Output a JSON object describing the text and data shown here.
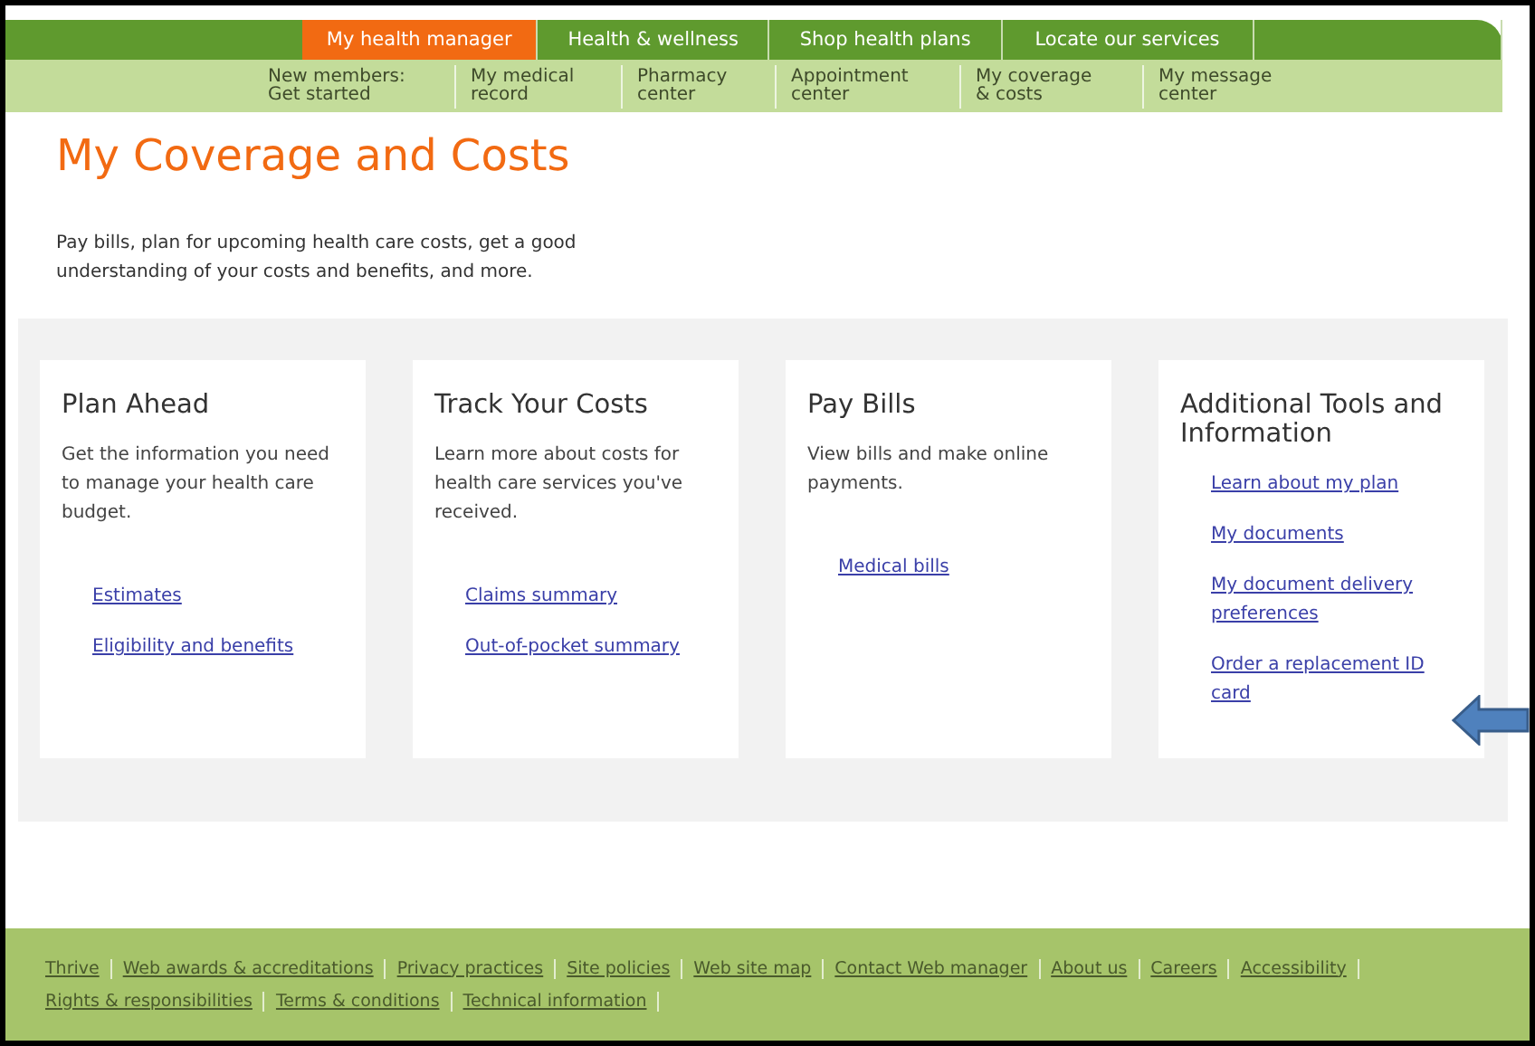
{
  "nav": {
    "tabs": [
      {
        "label": "My health manager",
        "selected": true
      },
      {
        "label": "Health & wellness",
        "selected": false
      },
      {
        "label": "Shop health plans",
        "selected": false
      },
      {
        "label": "Locate our services",
        "selected": false
      }
    ],
    "subnav": [
      "New members:\nGet started",
      "My medical\nrecord",
      "Pharmacy\ncenter",
      "Appointment\ncenter",
      "My coverage\n& costs",
      "My message\ncenter"
    ]
  },
  "page": {
    "title": "My Coverage and Costs",
    "intro": "Pay bills, plan for upcoming health care costs, get a good understanding of your costs and benefits, and more."
  },
  "cards": [
    {
      "title": "Plan Ahead",
      "text": "Get the information you need to manage your health care budget.",
      "links": [
        "Estimates",
        "Eligibility and benefits"
      ]
    },
    {
      "title": "Track Your Costs",
      "text": "Learn more about costs for health care services you've received.",
      "links": [
        "Claims summary",
        "Out-of-pocket summary"
      ]
    },
    {
      "title": "Pay Bills",
      "text": "View bills and make online payments.",
      "links": [
        "Medical bills"
      ]
    },
    {
      "title": "Additional Tools and Information",
      "links": [
        "Learn about my plan",
        "My documents",
        "My document delivery preferences",
        "Order a replacement ID card"
      ]
    }
  ],
  "footer": {
    "links": [
      [
        "Thrive",
        "Web awards & accreditations",
        "Privacy practices",
        "Site policies",
        "Web site map",
        "Contact Web manager",
        "About us",
        "Careers",
        "Accessibility"
      ],
      [
        "Rights & responsibilities",
        "Terms & conditions",
        "Technical information"
      ]
    ]
  }
}
